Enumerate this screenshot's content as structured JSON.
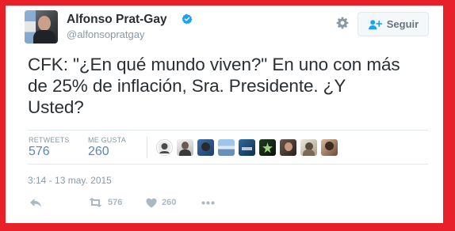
{
  "tweet": {
    "author": {
      "name": "Alfonso Prat-Gay",
      "handle": "@alfonsopratgay",
      "verified_icon": "verified-badge-icon"
    },
    "follow_button": {
      "label": "Seguir",
      "icon": "add-user-icon"
    },
    "settings_icon": "gear-icon",
    "text_lines": [
      "CFK: \"¿En qué mundo viven?\" En uno con más",
      "de 25% de inflación, Sra. Presidente. ¿Y",
      "Usted?"
    ],
    "stats": {
      "retweets_label": "RETWEETS",
      "retweets_value": "576",
      "likes_label": "ME GUSTA",
      "likes_value": "260"
    },
    "favoriter_avatars_count": 9,
    "timestamp": "3:14 - 13 may. 2015",
    "actions": {
      "reply_icon": "reply-icon",
      "retweet_icon": "retweet-icon",
      "retweet_count": "576",
      "like_icon": "heart-icon",
      "like_count": "260",
      "more_icon": "more-dots-icon"
    }
  },
  "colors": {
    "frame_border": "#e8202a",
    "verified_blue": "#1da1f2",
    "stat_value": "#5a87b6",
    "muted_text": "#8899a6",
    "action_icon": "#aab8c2"
  }
}
